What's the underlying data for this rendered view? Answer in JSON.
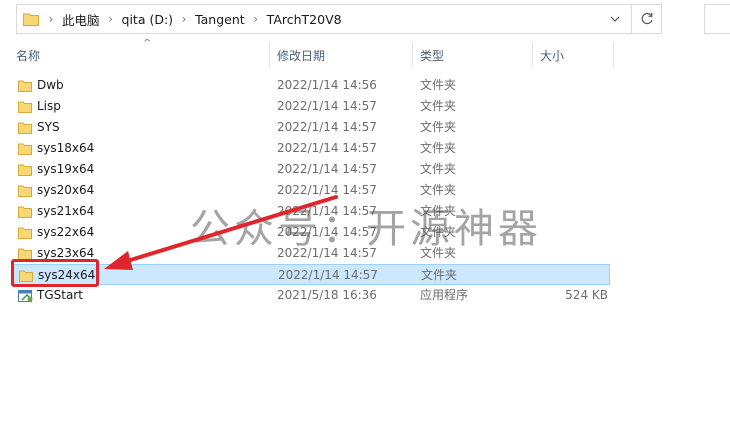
{
  "address_bar": {
    "breadcrumb": [
      "此电脑",
      "qita (D:)",
      "Tangent",
      "TArchT20V8"
    ]
  },
  "columns": {
    "name": "名称",
    "date": "修改日期",
    "type": "类型",
    "size": "大小"
  },
  "files": [
    {
      "name": "Dwb",
      "date": "2022/1/14 14:56",
      "type": "文件夹",
      "size": "",
      "icon": "folder-icon",
      "selected": false
    },
    {
      "name": "Lisp",
      "date": "2022/1/14 14:57",
      "type": "文件夹",
      "size": "",
      "icon": "folder-icon",
      "selected": false
    },
    {
      "name": "SYS",
      "date": "2022/1/14 14:57",
      "type": "文件夹",
      "size": "",
      "icon": "folder-icon",
      "selected": false
    },
    {
      "name": "sys18x64",
      "date": "2022/1/14 14:57",
      "type": "文件夹",
      "size": "",
      "icon": "folder-icon",
      "selected": false
    },
    {
      "name": "sys19x64",
      "date": "2022/1/14 14:57",
      "type": "文件夹",
      "size": "",
      "icon": "folder-icon",
      "selected": false
    },
    {
      "name": "sys20x64",
      "date": "2022/1/14 14:57",
      "type": "文件夹",
      "size": "",
      "icon": "folder-icon",
      "selected": false
    },
    {
      "name": "sys21x64",
      "date": "2022/1/14 14:57",
      "type": "文件夹",
      "size": "",
      "icon": "folder-icon",
      "selected": false
    },
    {
      "name": "sys22x64",
      "date": "2022/1/14 14:57",
      "type": "文件夹",
      "size": "",
      "icon": "folder-icon",
      "selected": false
    },
    {
      "name": "sys23x64",
      "date": "2022/1/14 14:57",
      "type": "文件夹",
      "size": "",
      "icon": "folder-icon",
      "selected": false
    },
    {
      "name": "sys24x64",
      "date": "2022/1/14 14:57",
      "type": "文件夹",
      "size": "",
      "icon": "folder-icon",
      "selected": true
    },
    {
      "name": "TGStart",
      "date": "2021/5/18 16:36",
      "type": "应用程序",
      "size": "524 KB",
      "icon": "application-icon",
      "selected": false
    }
  ],
  "watermark": "公众号：开源神器",
  "colors": {
    "selection_fill": "#cce8ff",
    "selection_border": "#99d1ff",
    "annotation_red": "#e0262a",
    "folder_yellow": "#f8d775"
  }
}
